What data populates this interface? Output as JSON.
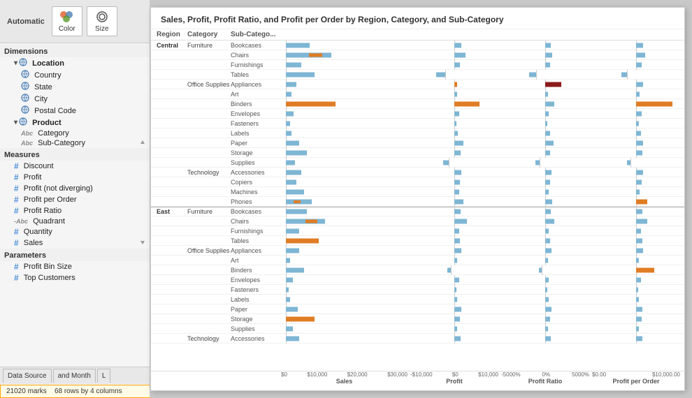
{
  "toolbar": {
    "automatic_label": "Automatic",
    "color_label": "Color",
    "size_label": "Size"
  },
  "dimensions": {
    "header": "Dimensions",
    "location_group": "Location",
    "location_items": [
      "Country",
      "State",
      "City",
      "Postal Code"
    ],
    "product_group": "Product",
    "product_items": [
      "Category",
      "Sub-Category"
    ]
  },
  "measures": {
    "header": "Measures",
    "items": [
      "Discount",
      "Profit",
      "Profit (not diverging)",
      "Profit per Order",
      "Profit Ratio",
      "Quadrant",
      "Quantity"
    ]
  },
  "parameters": {
    "header": "Parameters",
    "items": [
      "Profit Bin Size",
      "Top Customers"
    ]
  },
  "status_bar": {
    "tab1": "Data Source",
    "tab2": "and Month",
    "tab3": "L",
    "marks": "21020 marks",
    "rows_cols": "68 rows by 4 columns"
  },
  "chart": {
    "title": "Sales, Profit, Profit Ratio, and Profit per Order by Region, Category, and Sub-Category",
    "columns": [
      "Region",
      "Category",
      "Sub-Catego...",
      "Sales",
      "Profit",
      "Profit Ratio",
      "Profit per Order"
    ],
    "axis1_labels": [
      "$0",
      "$10,000",
      "$20,000",
      "$30,000"
    ],
    "axis1_title": "Sales",
    "axis2_labels": [
      "-$10,000",
      "$0",
      "$10,000"
    ],
    "axis2_title": "Profit",
    "axis3_labels": [
      "-5000%",
      "0%",
      "5000%"
    ],
    "axis3_title": "Profit Ratio",
    "axis4_labels": [
      "$0.00",
      "$10,000.00"
    ],
    "axis4_title": "Profit per Order",
    "rows": [
      {
        "region": "Central",
        "category": "Furniture",
        "subcategory": "Bookcases",
        "b1_type": "blue",
        "b1_start": 5,
        "b1_len": 18,
        "b2_type": "blue",
        "b2_neg": false,
        "b2_start": 50,
        "b2_len": 8,
        "b3_type": "blue",
        "b3_neg": false,
        "b3_start": 50,
        "b3_len": 6,
        "b4_type": "blue",
        "b4_neg": false,
        "b4_start": 50,
        "b4_len": 8
      },
      {
        "region": "",
        "category": "",
        "subcategory": "Chairs",
        "b1_type": "mixed",
        "b1_start": 5,
        "b1_len": 35,
        "b2_type": "blue",
        "b2_neg": false,
        "b2_start": 50,
        "b2_len": 12,
        "b3_type": "blue",
        "b3_neg": false,
        "b3_start": 50,
        "b3_len": 8,
        "b4_type": "blue",
        "b4_neg": false,
        "b4_start": 50,
        "b4_len": 10
      },
      {
        "region": "",
        "category": "",
        "subcategory": "Furnishings",
        "b1_type": "blue",
        "b1_start": 5,
        "b1_len": 12,
        "b2_type": "blue",
        "b2_neg": false,
        "b2_start": 50,
        "b2_len": 6,
        "b3_type": "blue",
        "b3_neg": false,
        "b3_start": 50,
        "b3_len": 5,
        "b4_type": "blue",
        "b4_neg": false,
        "b4_start": 50,
        "b4_len": 6
      },
      {
        "region": "",
        "category": "",
        "subcategory": "Tables",
        "b1_type": "blue",
        "b1_start": 5,
        "b1_len": 22,
        "b2_type": "blue",
        "b2_neg": true,
        "b2_start": 40,
        "b2_len": 10,
        "b3_type": "blue",
        "b3_neg": true,
        "b3_start": 40,
        "b3_len": 8,
        "b4_type": "blue",
        "b4_neg": true,
        "b4_start": 40,
        "b4_len": 6
      },
      {
        "region": "",
        "category": "Office Supplies",
        "subcategory": "Appliances",
        "b1_type": "blue",
        "b1_start": 5,
        "b1_len": 8,
        "b2_type": "orange",
        "b2_neg": false,
        "b2_start": 50,
        "b2_len": 3,
        "b3_type": "darkred",
        "b3_neg": false,
        "b3_start": 50,
        "b3_len": 18,
        "b4_type": "blue",
        "b4_neg": false,
        "b4_start": 50,
        "b4_len": 8
      },
      {
        "region": "",
        "category": "",
        "subcategory": "Art",
        "b1_type": "blue",
        "b1_start": 5,
        "b1_len": 4,
        "b2_type": "blue",
        "b2_neg": false,
        "b2_start": 50,
        "b2_len": 3,
        "b3_type": "blue",
        "b3_neg": false,
        "b3_start": 50,
        "b3_len": 3,
        "b4_type": "blue",
        "b4_neg": false,
        "b4_start": 50,
        "b4_len": 4
      },
      {
        "region": "",
        "category": "",
        "subcategory": "Binders",
        "b1_type": "orange",
        "b1_start": 5,
        "b1_len": 38,
        "b2_type": "orange",
        "b2_neg": false,
        "b2_start": 50,
        "b2_len": 28,
        "b3_type": "blue",
        "b3_neg": false,
        "b3_start": 50,
        "b3_len": 10,
        "b4_type": "orange",
        "b4_neg": false,
        "b4_start": 50,
        "b4_len": 40
      },
      {
        "region": "",
        "category": "",
        "subcategory": "Envelopes",
        "b1_type": "blue",
        "b1_start": 5,
        "b1_len": 6,
        "b2_type": "blue",
        "b2_neg": false,
        "b2_start": 50,
        "b2_len": 5,
        "b3_type": "blue",
        "b3_neg": false,
        "b3_start": 50,
        "b3_len": 4,
        "b4_type": "blue",
        "b4_neg": false,
        "b4_start": 50,
        "b4_len": 6
      },
      {
        "region": "",
        "category": "",
        "subcategory": "Fasteners",
        "b1_type": "blue",
        "b1_start": 5,
        "b1_len": 3,
        "b2_type": "blue",
        "b2_neg": false,
        "b2_start": 50,
        "b2_len": 2,
        "b3_type": "blue",
        "b3_neg": false,
        "b3_start": 50,
        "b3_len": 2,
        "b4_type": "blue",
        "b4_neg": false,
        "b4_start": 50,
        "b4_len": 3
      },
      {
        "region": "",
        "category": "",
        "subcategory": "Labels",
        "b1_type": "blue",
        "b1_start": 5,
        "b1_len": 4,
        "b2_type": "blue",
        "b2_neg": false,
        "b2_start": 50,
        "b2_len": 4,
        "b3_type": "blue",
        "b3_neg": false,
        "b3_start": 50,
        "b3_len": 5,
        "b4_type": "blue",
        "b4_neg": false,
        "b4_start": 50,
        "b4_len": 5
      },
      {
        "region": "",
        "category": "",
        "subcategory": "Paper",
        "b1_type": "blue",
        "b1_start": 5,
        "b1_len": 10,
        "b2_type": "blue",
        "b2_neg": false,
        "b2_start": 50,
        "b2_len": 10,
        "b3_type": "blue",
        "b3_neg": false,
        "b3_start": 50,
        "b3_len": 9,
        "b4_type": "blue",
        "b4_neg": false,
        "b4_start": 50,
        "b4_len": 8
      },
      {
        "region": "",
        "category": "",
        "subcategory": "Storage",
        "b1_type": "blue",
        "b1_start": 5,
        "b1_len": 16,
        "b2_type": "blue",
        "b2_neg": false,
        "b2_start": 50,
        "b2_len": 7,
        "b3_type": "blue",
        "b3_neg": false,
        "b3_start": 50,
        "b3_len": 5,
        "b4_type": "blue",
        "b4_neg": false,
        "b4_start": 50,
        "b4_len": 7
      },
      {
        "region": "",
        "category": "",
        "subcategory": "Supplies",
        "b1_type": "blue",
        "b1_start": 5,
        "b1_len": 7,
        "b2_type": "blue",
        "b2_neg": true,
        "b2_start": 44,
        "b2_len": 6,
        "b3_type": "blue",
        "b3_neg": true,
        "b3_start": 44,
        "b3_len": 5,
        "b4_type": "blue",
        "b4_neg": true,
        "b4_start": 44,
        "b4_len": 4
      },
      {
        "region": "",
        "category": "Technology",
        "subcategory": "Accessories",
        "b1_type": "blue",
        "b1_start": 5,
        "b1_len": 12,
        "b2_type": "blue",
        "b2_neg": false,
        "b2_start": 50,
        "b2_len": 8,
        "b3_type": "blue",
        "b3_neg": false,
        "b3_start": 50,
        "b3_len": 7,
        "b4_type": "blue",
        "b4_neg": false,
        "b4_start": 50,
        "b4_len": 8
      },
      {
        "region": "",
        "category": "",
        "subcategory": "Copiers",
        "b1_type": "blue",
        "b1_start": 5,
        "b1_len": 8,
        "b2_type": "blue",
        "b2_neg": false,
        "b2_start": 50,
        "b2_len": 6,
        "b3_type": "blue",
        "b3_neg": false,
        "b3_start": 50,
        "b3_len": 5,
        "b4_type": "blue",
        "b4_neg": false,
        "b4_start": 50,
        "b4_len": 6
      },
      {
        "region": "",
        "category": "",
        "subcategory": "Machines",
        "b1_type": "blue",
        "b1_start": 5,
        "b1_len": 14,
        "b2_type": "blue",
        "b2_neg": false,
        "b2_start": 50,
        "b2_len": 5,
        "b3_type": "blue",
        "b3_neg": false,
        "b3_start": 50,
        "b3_len": 4,
        "b4_type": "blue",
        "b4_neg": false,
        "b4_start": 50,
        "b4_len": 4
      },
      {
        "region": "",
        "category": "",
        "subcategory": "Phones",
        "b1_type": "mixed2",
        "b1_start": 5,
        "b1_len": 20,
        "b2_type": "blue",
        "b2_neg": false,
        "b2_start": 50,
        "b2_len": 10,
        "b3_type": "blue",
        "b3_neg": false,
        "b3_start": 50,
        "b3_len": 8,
        "b4_type": "orange",
        "b4_neg": false,
        "b4_start": 50,
        "b4_len": 12
      },
      {
        "region": "East",
        "category": "Furniture",
        "subcategory": "Bookcases",
        "b1_type": "blue",
        "b1_start": 5,
        "b1_len": 16,
        "b2_type": "blue",
        "b2_neg": false,
        "b2_start": 50,
        "b2_len": 7,
        "b3_type": "blue",
        "b3_neg": false,
        "b3_start": 50,
        "b3_len": 6,
        "b4_type": "blue",
        "b4_neg": false,
        "b4_start": 50,
        "b4_len": 7,
        "divider": true
      },
      {
        "region": "",
        "category": "",
        "subcategory": "Chairs",
        "b1_type": "mixed",
        "b1_start": 5,
        "b1_len": 30,
        "b2_type": "blue",
        "b2_neg": false,
        "b2_start": 50,
        "b2_len": 14,
        "b3_type": "blue",
        "b3_neg": false,
        "b3_start": 50,
        "b3_len": 10,
        "b4_type": "blue",
        "b4_neg": false,
        "b4_start": 50,
        "b4_len": 12
      },
      {
        "region": "",
        "category": "",
        "subcategory": "Furnishings",
        "b1_type": "blue",
        "b1_start": 5,
        "b1_len": 10,
        "b2_type": "blue",
        "b2_neg": false,
        "b2_start": 50,
        "b2_len": 5,
        "b3_type": "blue",
        "b3_neg": false,
        "b3_start": 50,
        "b3_len": 4,
        "b4_type": "blue",
        "b4_neg": false,
        "b4_start": 50,
        "b4_len": 5
      },
      {
        "region": "",
        "category": "",
        "subcategory": "Tables",
        "b1_type": "orange",
        "b1_start": 5,
        "b1_len": 25,
        "b2_type": "blue",
        "b2_neg": false,
        "b2_start": 50,
        "b2_len": 6,
        "b3_type": "blue",
        "b3_neg": false,
        "b3_start": 50,
        "b3_len": 5,
        "b4_type": "blue",
        "b4_neg": false,
        "b4_start": 50,
        "b4_len": 7
      },
      {
        "region": "",
        "category": "Office Supplies",
        "subcategory": "Appliances",
        "b1_type": "blue",
        "b1_start": 5,
        "b1_len": 10,
        "b2_type": "blue",
        "b2_neg": false,
        "b2_start": 50,
        "b2_len": 8,
        "b3_type": "blue",
        "b3_neg": false,
        "b3_start": 50,
        "b3_len": 7,
        "b4_type": "blue",
        "b4_neg": false,
        "b4_start": 50,
        "b4_len": 8
      },
      {
        "region": "",
        "category": "",
        "subcategory": "Art",
        "b1_type": "blue",
        "b1_start": 5,
        "b1_len": 3,
        "b2_type": "blue",
        "b2_neg": false,
        "b2_start": 50,
        "b2_len": 3,
        "b3_type": "blue",
        "b3_neg": false,
        "b3_start": 50,
        "b3_len": 3,
        "b4_type": "blue",
        "b4_neg": false,
        "b4_start": 50,
        "b4_len": 3
      },
      {
        "region": "",
        "category": "",
        "subcategory": "Binders",
        "b1_type": "blue",
        "b1_start": 5,
        "b1_len": 14,
        "b2_type": "blue",
        "b2_neg": true,
        "b2_start": 46,
        "b2_len": 4,
        "b3_type": "blue",
        "b3_neg": true,
        "b3_start": 46,
        "b3_len": 3,
        "b4_type": "orange",
        "b4_neg": false,
        "b4_start": 50,
        "b4_len": 20
      },
      {
        "region": "",
        "category": "",
        "subcategory": "Envelopes",
        "b1_type": "blue",
        "b1_start": 5,
        "b1_len": 5,
        "b2_type": "blue",
        "b2_neg": false,
        "b2_start": 50,
        "b2_len": 5,
        "b3_type": "blue",
        "b3_neg": false,
        "b3_start": 50,
        "b3_len": 4,
        "b4_type": "blue",
        "b4_neg": false,
        "b4_start": 50,
        "b4_len": 5
      },
      {
        "region": "",
        "category": "",
        "subcategory": "Fasteners",
        "b1_type": "blue",
        "b1_start": 5,
        "b1_len": 2,
        "b2_type": "blue",
        "b2_neg": false,
        "b2_start": 50,
        "b2_len": 2,
        "b3_type": "blue",
        "b3_neg": false,
        "b3_start": 50,
        "b3_len": 2,
        "b4_type": "blue",
        "b4_neg": false,
        "b4_start": 50,
        "b4_len": 2
      },
      {
        "region": "",
        "category": "",
        "subcategory": "Labels",
        "b1_type": "blue",
        "b1_start": 5,
        "b1_len": 3,
        "b2_type": "blue",
        "b2_neg": false,
        "b2_start": 50,
        "b2_len": 3,
        "b3_type": "blue",
        "b3_neg": false,
        "b3_start": 50,
        "b3_len": 4,
        "b4_type": "blue",
        "b4_neg": false,
        "b4_start": 50,
        "b4_len": 3
      },
      {
        "region": "",
        "category": "",
        "subcategory": "Paper",
        "b1_type": "blue",
        "b1_start": 5,
        "b1_len": 9,
        "b2_type": "blue",
        "b2_neg": false,
        "b2_start": 50,
        "b2_len": 8,
        "b3_type": "blue",
        "b3_neg": false,
        "b3_start": 50,
        "b3_len": 7,
        "b4_type": "blue",
        "b4_neg": false,
        "b4_start": 50,
        "b4_len": 7
      },
      {
        "region": "",
        "category": "",
        "subcategory": "Storage",
        "b1_type": "orange",
        "b1_start": 5,
        "b1_len": 22,
        "b2_type": "blue",
        "b2_neg": false,
        "b2_start": 50,
        "b2_len": 6,
        "b3_type": "blue",
        "b3_neg": false,
        "b3_start": 50,
        "b3_len": 5,
        "b4_type": "blue",
        "b4_neg": false,
        "b4_start": 50,
        "b4_len": 6
      },
      {
        "region": "",
        "category": "",
        "subcategory": "Supplies",
        "b1_type": "blue",
        "b1_start": 5,
        "b1_len": 5,
        "b2_type": "blue",
        "b2_neg": false,
        "b2_start": 50,
        "b2_len": 3,
        "b3_type": "blue",
        "b3_neg": false,
        "b3_start": 50,
        "b3_len": 3,
        "b4_type": "blue",
        "b4_neg": false,
        "b4_start": 50,
        "b4_len": 3
      },
      {
        "region": "",
        "category": "Technology",
        "subcategory": "Accessories",
        "b1_type": "blue",
        "b1_start": 5,
        "b1_len": 10,
        "b2_type": "blue",
        "b2_neg": false,
        "b2_start": 50,
        "b2_len": 7,
        "b3_type": "blue",
        "b3_neg": false,
        "b3_start": 50,
        "b3_len": 6,
        "b4_type": "blue",
        "b4_neg": false,
        "b4_start": 50,
        "b4_len": 7
      }
    ]
  }
}
